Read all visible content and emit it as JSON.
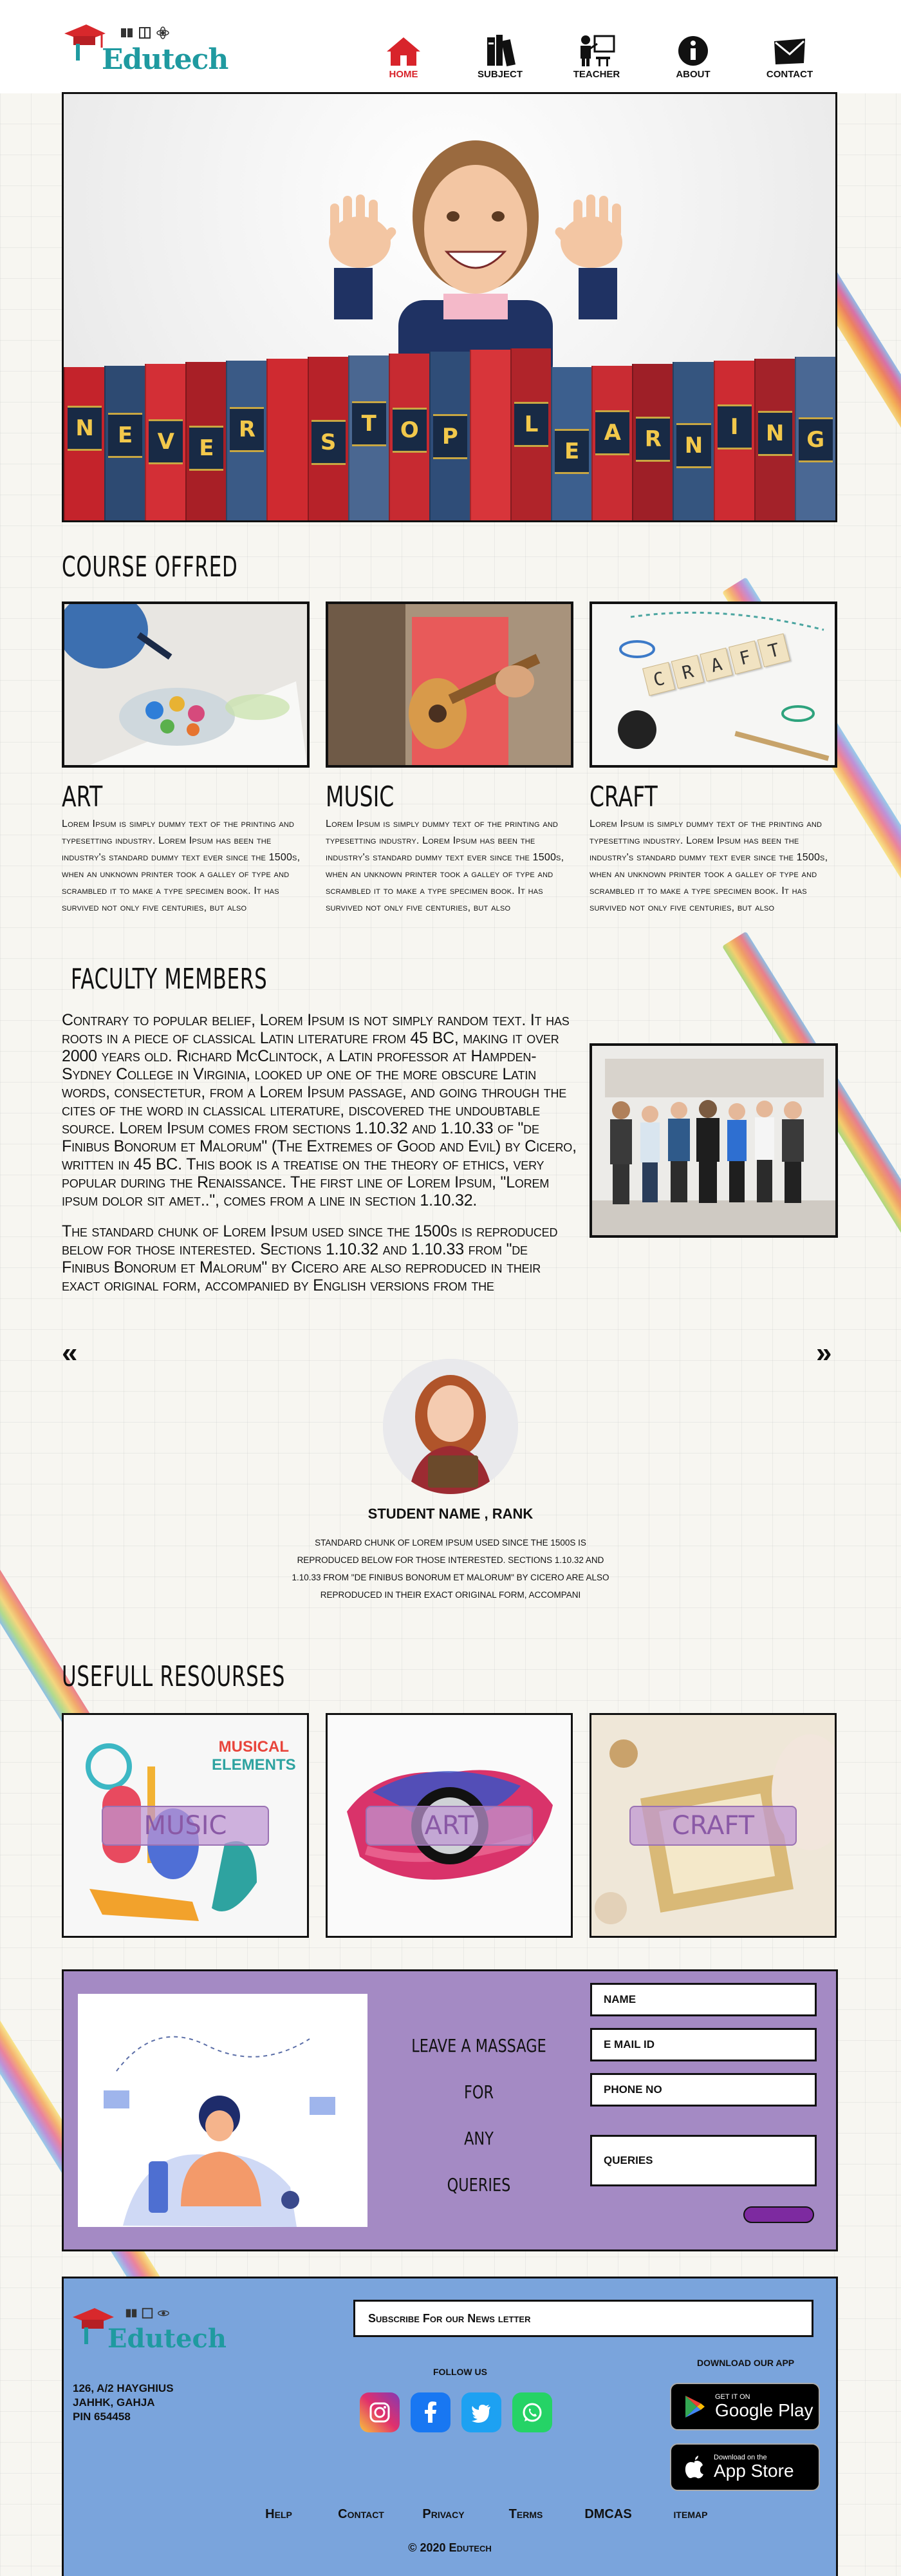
{
  "header": {
    "logo_text": "Edutech",
    "nav": [
      {
        "label": "HOME",
        "icon": "home-icon",
        "active": true
      },
      {
        "label": "SUBJECT",
        "icon": "books-icon"
      },
      {
        "label": "TEACHER",
        "icon": "teacher-icon"
      },
      {
        "label": "ABOUT",
        "icon": "info-icon"
      },
      {
        "label": "CONTACT",
        "icon": "envelope-icon"
      }
    ]
  },
  "hero": {
    "letters": [
      "N",
      "E",
      "V",
      "E",
      "R",
      "",
      "S",
      "T",
      "O",
      "P",
      "",
      "L",
      "E",
      "A",
      "R",
      "N",
      "I",
      "N",
      "G"
    ]
  },
  "courses": {
    "title": "COURSE OFFRED",
    "items": [
      {
        "name": "ART",
        "desc": "Lorem Ipsum is simply dummy text of the printing and typesetting industry. Lorem Ipsum has been the industry's standard dummy text ever since the 1500s, when an unknown printer took a galley of type and scrambled it to make a type specimen book. It has survived not only five centuries, but also"
      },
      {
        "name": "MUSIC",
        "desc": "Lorem Ipsum is simply dummy text of the printing and typesetting industry. Lorem Ipsum has been the industry's standard dummy text ever since the 1500s, when an unknown printer took a galley of type and scrambled it to make a type specimen book. It has survived not only five centuries, but also"
      },
      {
        "name": "CRAFT",
        "desc": "Lorem Ipsum is simply dummy text of the printing and typesetting industry. Lorem Ipsum has been the industry's standard dummy text ever since the 1500s, when an unknown printer took a galley of type and scrambled it to make a type specimen book. It has survived not only five centuries, but also"
      }
    ],
    "craft_tiles": [
      "C",
      "R",
      "A",
      "F",
      "T"
    ]
  },
  "faculty": {
    "title": "FACULTY MEMBERS",
    "para1": "Contrary to popular belief, Lorem Ipsum is not simply random text. It has roots in a piece of classical Latin literature from 45 BC, making it over 2000 years old. Richard McClintock, a Latin professor at Hampden-Sydney College in Virginia, looked up one of the more obscure Latin words, consectetur, from a Lorem Ipsum passage, and going through the cites of the word in classical literature, discovered the undoubtable source. Lorem Ipsum comes from sections 1.10.32 and 1.10.33 of \"de Finibus Bonorum et Malorum\" (The Extremes of Good and Evil) by Cicero, written in 45 BC. This book is a treatise on the theory of ethics, very popular during the Renaissance. The first line of Lorem Ipsum, \"Lorem ipsum dolor sit amet..\", comes from a line in section 1.10.32.",
    "para2": "The standard chunk of Lorem Ipsum used since the 1500s is reproduced below for those interested. Sections 1.10.32 and 1.10.33 from \"de Finibus Bonorum et Malorum\" by Cicero are also reproduced in their exact original form, accompanied by English versions from the"
  },
  "testimonial": {
    "prev": "«",
    "next": "»",
    "name": "STUDENT NAME , RANK",
    "quote": "standard chunk of Lorem Ipsum used since the 1500s is reproduced below for those interested. Sections 1.10.32 and 1.10.33 from \"de Finibus Bonorum et Malorum\" by Cicero are also reproduced in their exact original form, accompani"
  },
  "resources": {
    "title": "USEFULL RESOURSES",
    "items": [
      {
        "label": "MUSIC",
        "caption_line1": "MUSICAL",
        "caption_line2": "ELEMENTS"
      },
      {
        "label": "ART"
      },
      {
        "label": "CRAFT"
      }
    ]
  },
  "contact": {
    "heading_lines": [
      "LEAVE A MASSAGE FOR",
      "ANY",
      "QUERIES"
    ],
    "fields": {
      "name": "NAME",
      "email": "E MAIL ID",
      "phone": "PHONE NO",
      "queries": "QUERIES"
    }
  },
  "footer": {
    "logo_text": "Edutech",
    "address_lines": [
      "126, A/2 hayghius",
      "jahhk, gahja",
      "pin 654458"
    ],
    "subscribe_placeholder": "Subscribe For our News letter",
    "follow": "FOLLOW US",
    "social": [
      "instagram-icon",
      "facebook-icon",
      "twitter-icon",
      "whatsapp-icon"
    ],
    "download": "DOWNLOAD OUR APP",
    "google_small": "GET IT ON",
    "google_big": "Google Play",
    "apple_small": "Download on the",
    "apple_big": "App Store",
    "links": [
      "Help",
      "Contact",
      "Privacy",
      "Terms",
      "DMCAS",
      "itemap"
    ],
    "copyright": "© 2020 Edutech"
  },
  "colors": {
    "accent_red": "#d8242b",
    "logo_teal": "#1f9aa0",
    "contact_bg": "#a48ac4",
    "footer_bg": "#7aa4dc",
    "submit": "#7d2aa0"
  }
}
